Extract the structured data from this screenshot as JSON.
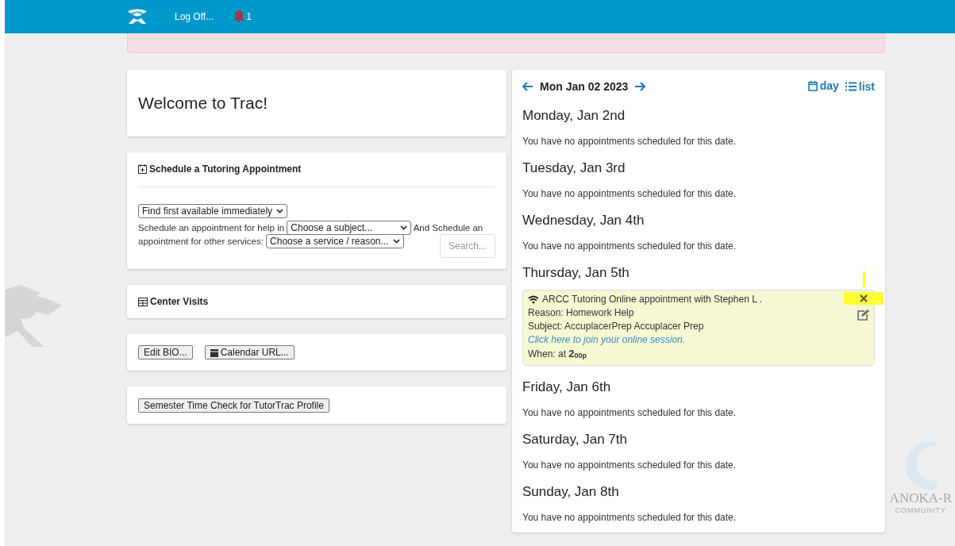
{
  "topbar": {
    "logoff": "Log Off...",
    "notifications": "1"
  },
  "alert": {
    "visible": true
  },
  "welcome": {
    "title": "Welcome to Trac!"
  },
  "schedule": {
    "title": "Schedule a Tutoring Appointment",
    "mode_select": "Find first available immediately",
    "text_before": "Schedule an appointment for help in",
    "subject_select": "Choose a subject...",
    "text_middle": "And Schedule an",
    "text_middle_2": "appointment for other services:",
    "service_select": "Choose a service / reason...",
    "search_button": "Search..."
  },
  "visits": {
    "title": "Center Visits"
  },
  "buttons": [
    "Edit BIO...",
    "Calendar URL..."
  ],
  "time_check": {
    "button": "Semester Time Check for TutorTrac Profile"
  },
  "calendar": {
    "date": "Mon Jan 02 2023",
    "views": [
      {
        "label": "day",
        "kind": "day"
      },
      {
        "label": "list",
        "kind": "list"
      }
    ],
    "days": [
      {
        "title": "Monday, Jan 2nd",
        "kind": "none",
        "message": "You have no appointments scheduled for this date."
      },
      {
        "title": "Tuesday, Jan 3rd",
        "kind": "none",
        "message": "You have no appointments scheduled for this date."
      },
      {
        "title": "Wednesday, Jan 4th",
        "kind": "none",
        "message": "You have no appointments scheduled for this date."
      },
      {
        "title": "Thursday, Jan 5th",
        "kind": "appointment",
        "appointment": {
          "headline": "ARCC Tutoring Online appointment with Stephen L .",
          "reason": "Reason: Homework Help",
          "subject": "Subject: AccuplacerPrep Accuplacer Prep",
          "link": "Click here to join your online session.",
          "when": "When: at **2**$_{00p}$",
          "close_highlighted": true
        }
      },
      {
        "title": "Friday, Jan 6th",
        "kind": "none",
        "message": "You have no appointments scheduled for this date."
      },
      {
        "title": "Saturday, Jan 7th",
        "kind": "none",
        "message": "You have no appointments scheduled for this date."
      },
      {
        "title": "Sunday, Jan 8th",
        "kind": "none",
        "message": "You have no appointments scheduled for this date."
      }
    ]
  },
  "background_logo": {
    "name": "ANOKA-R",
    "tagline": "COMMUNITY"
  }
}
